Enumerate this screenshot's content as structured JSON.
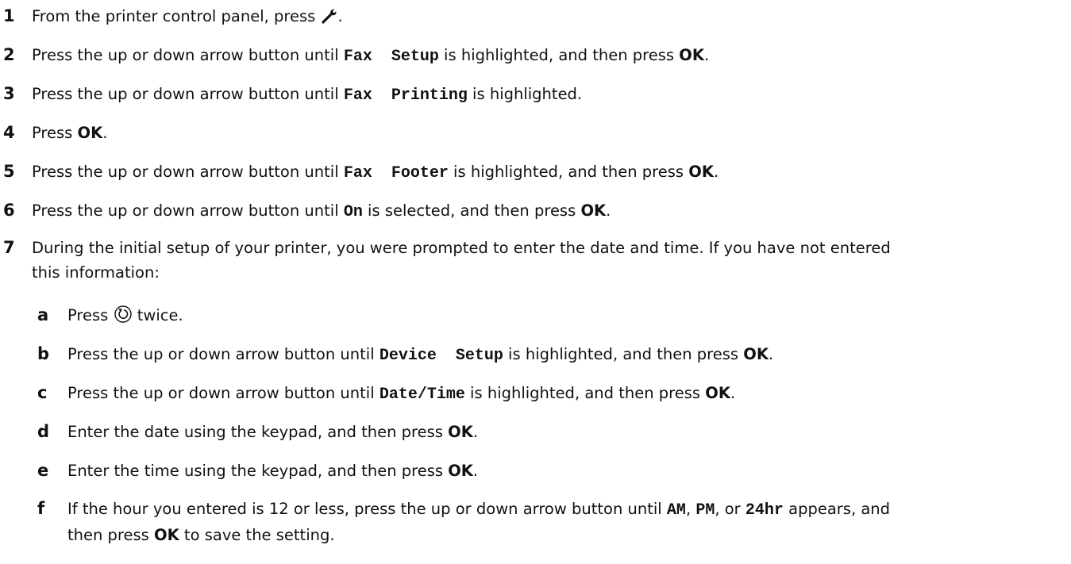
{
  "steps": [
    {
      "num": "1",
      "t1": "From the printer control panel, press ",
      "icon": "wrench-icon",
      "t2": "."
    },
    {
      "num": "2",
      "t1": "Press the up or down arrow button until ",
      "mono": "Fax  Setup",
      "t2": " is highlighted, and then press ",
      "bold": "OK",
      "t3": "."
    },
    {
      "num": "3",
      "t1": "Press the up or down arrow button until ",
      "mono": "Fax  Printing",
      "t2": " is highlighted."
    },
    {
      "num": "4",
      "t1": "Press ",
      "bold": "OK",
      "t2": "."
    },
    {
      "num": "5",
      "t1": "Press the up or down arrow button until ",
      "mono": "Fax  Footer",
      "t2": " is highlighted, and then press ",
      "bold": "OK",
      "t3": "."
    },
    {
      "num": "6",
      "t1": "Press the up or down arrow button until ",
      "mono": "On",
      "t2": " is selected, and then press ",
      "bold": "OK",
      "t3": "."
    },
    {
      "num": "7",
      "line1": "During the initial setup of your printer, you were prompted to enter the date and time. If you have not entered",
      "line2": "this information:"
    }
  ],
  "substeps": [
    {
      "num": "a",
      "t1": "Press ",
      "icon": "back-icon",
      "t2": " twice."
    },
    {
      "num": "b",
      "t1": "Press the up or down arrow button until ",
      "mono": "Device  Setup",
      "t2": " is highlighted, and then press ",
      "bold": "OK",
      "t3": "."
    },
    {
      "num": "c",
      "t1": "Press the up or down arrow button until ",
      "mono": "Date/Time",
      "t2": " is highlighted, and then press ",
      "bold": "OK",
      "t3": "."
    },
    {
      "num": "d",
      "t1": "Enter the date using the keypad, and then press ",
      "bold": "OK",
      "t2": "."
    },
    {
      "num": "e",
      "t1": "Enter the time using the keypad, and then press ",
      "bold": "OK",
      "t2": "."
    },
    {
      "num": "f",
      "t1": "If the hour you entered is 12 or less, press the up or down arrow button until ",
      "m1": "AM",
      "s1": ", ",
      "m2": "PM",
      "s2": ", or ",
      "m3": "24hr",
      "s3": " appears, and",
      "line2a": "then press ",
      "bold": "OK",
      "line2b": " to save the setting."
    }
  ]
}
